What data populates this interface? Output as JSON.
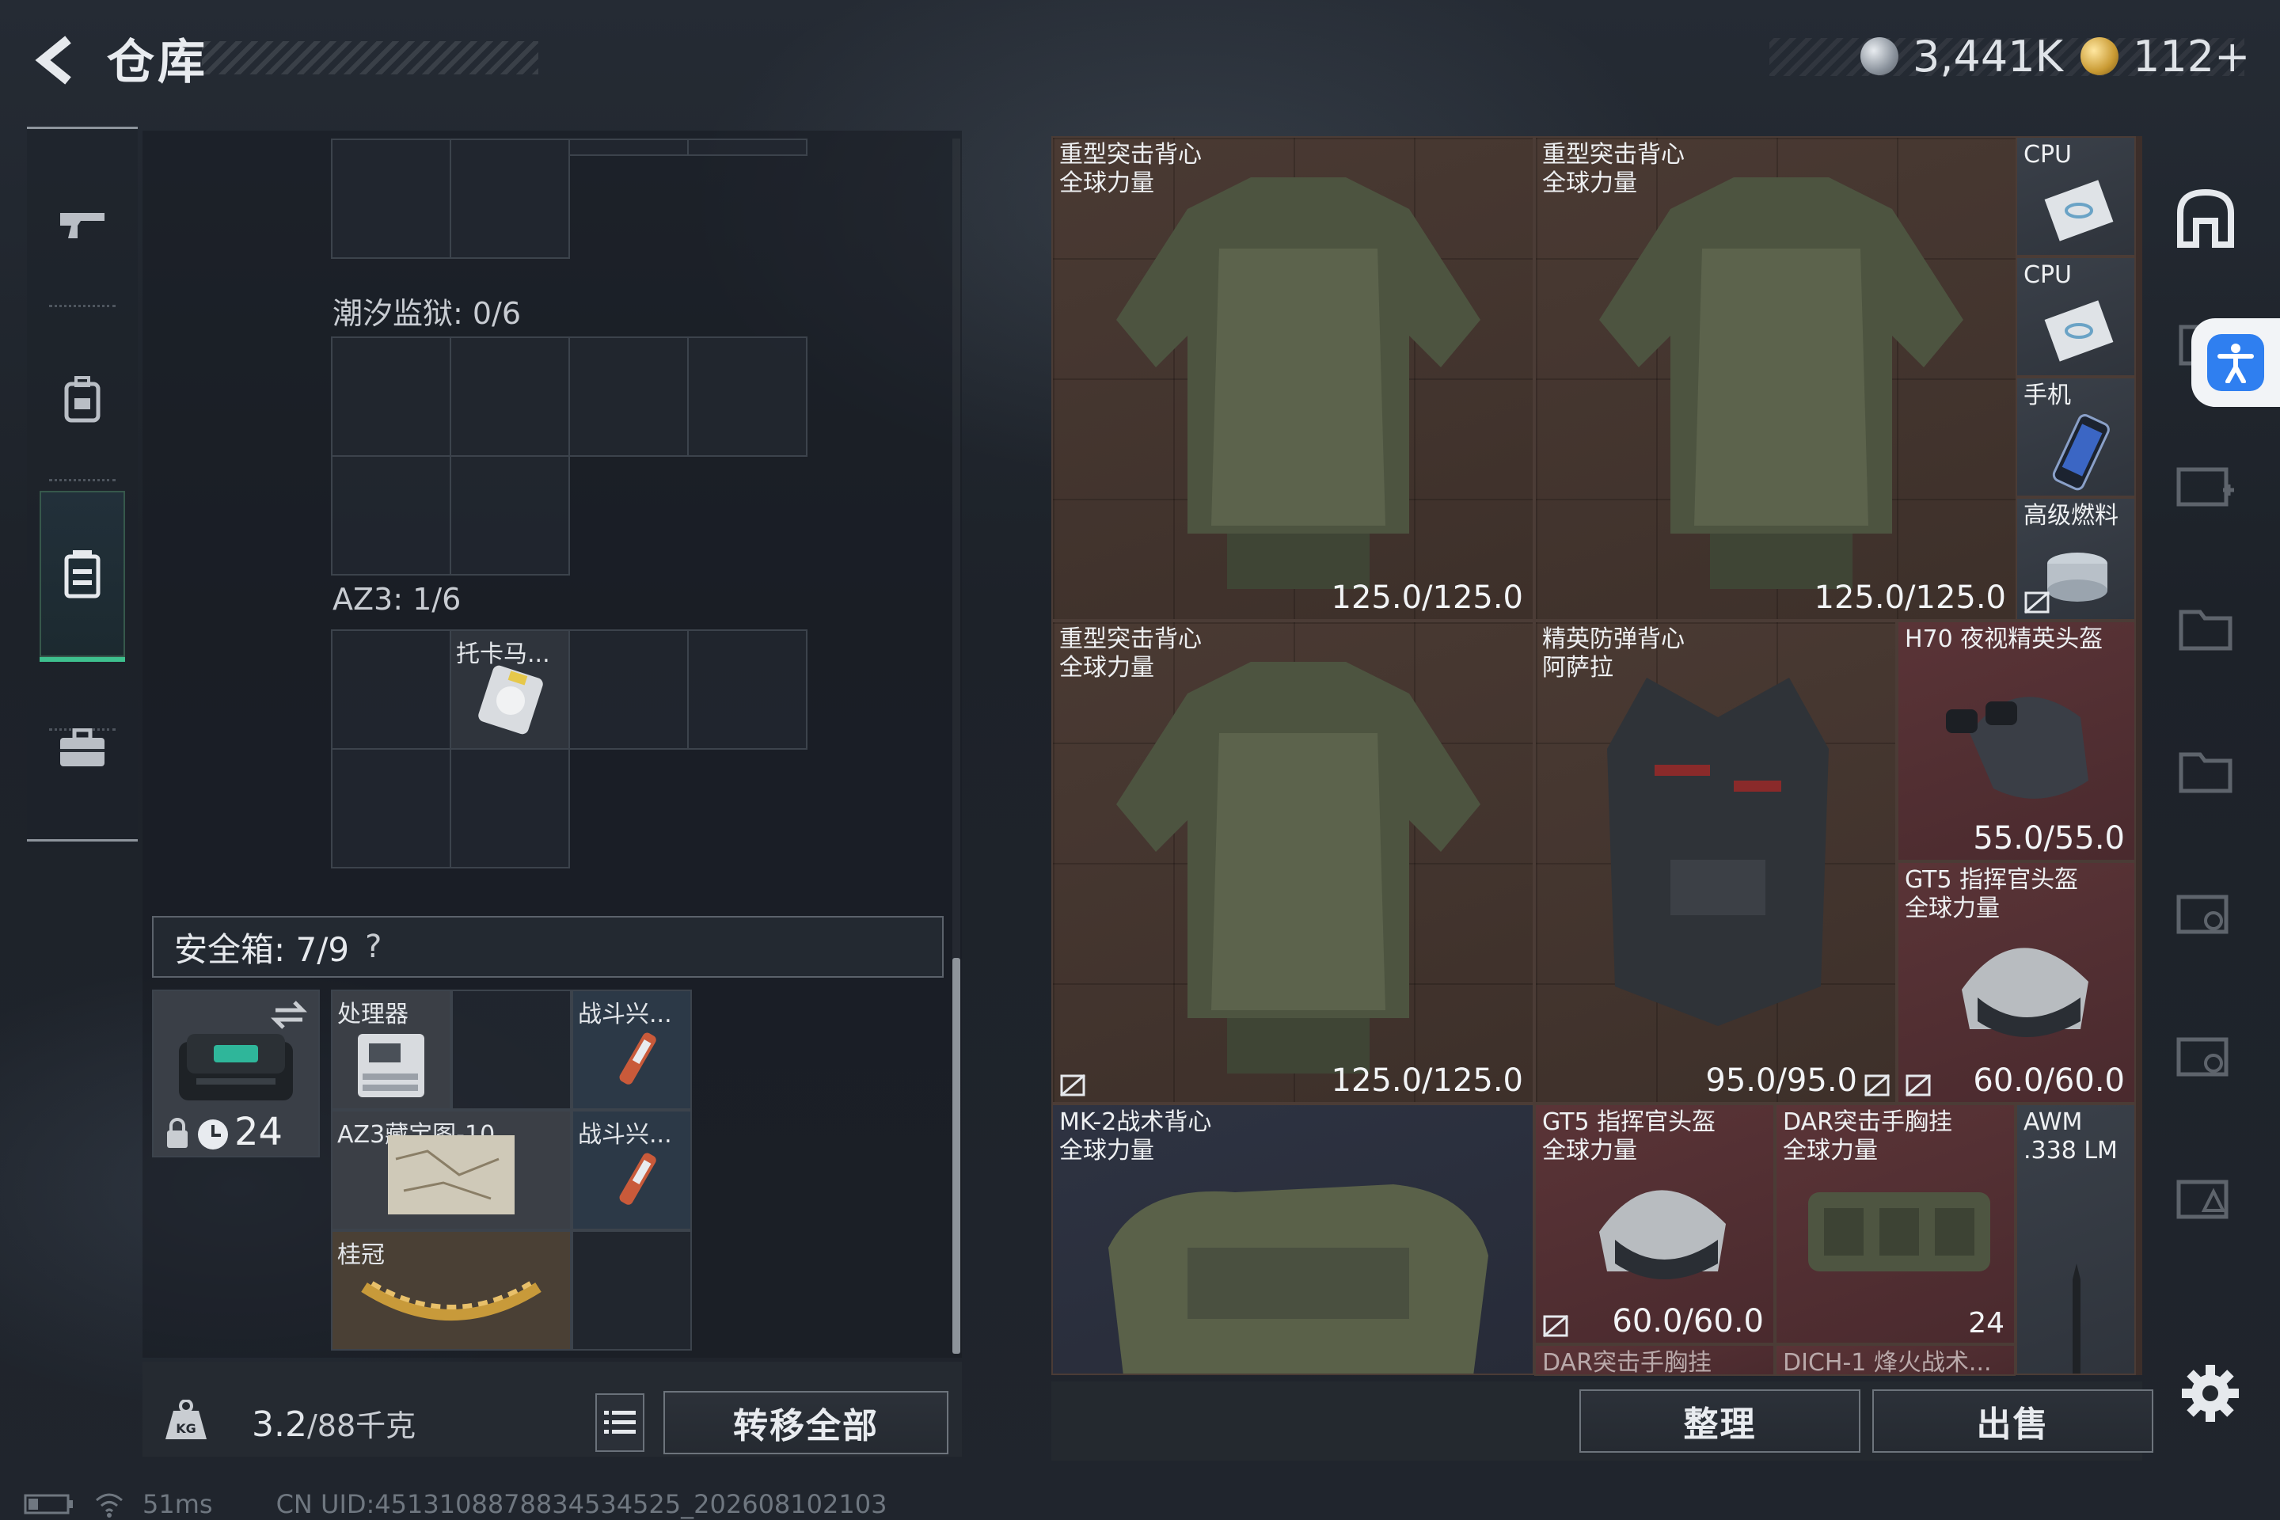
{
  "header": {
    "title": "仓库"
  },
  "currency": {
    "silver": "3,441K",
    "gold": "112+"
  },
  "stash": {
    "tidal_label": "潮汐监狱: 0/6",
    "az3_label": "AZ3: 1/6",
    "az3_item": "托卡马..."
  },
  "safe_box": {
    "label": "安全箱: 7/9",
    "help": "?",
    "timer": "24天",
    "items": {
      "processor": "处理器",
      "combat1": "战斗兴...",
      "map": "AZ3藏宝图-10",
      "combat2": "战斗兴...",
      "laurel": "桂冠"
    }
  },
  "footer_left": {
    "weight_value": "3.2",
    "weight_max": "/88千克",
    "transfer_all": "转移全部"
  },
  "tiles": {
    "vest1": {
      "name": "重型突击背心\n全球力量",
      "durability": "125.0/125.0"
    },
    "vest2": {
      "name": "重型突击背心\n全球力量",
      "durability": "125.0/125.0"
    },
    "cpu1": {
      "name": "CPU"
    },
    "cpu2": {
      "name": "CPU"
    },
    "phone": {
      "name": "手机"
    },
    "fuel": {
      "name": "高级燃料"
    },
    "vest3": {
      "name": "重型突击背心\n全球力量",
      "durability": "125.0/125.0"
    },
    "elite": {
      "name": "精英防弹背心\n阿萨拉",
      "durability": "95.0/95.0"
    },
    "h70": {
      "name": "H70 夜视精英头盔",
      "durability": "55.0/55.0"
    },
    "gt5a": {
      "name": "GT5 指挥官头盔\n全球力量",
      "durability": "60.0/60.0"
    },
    "mk2": {
      "name": "MK-2战术背心\n全球力量"
    },
    "gt5b": {
      "name": "GT5 指挥官头盔\n全球力量",
      "durability": "60.0/60.0"
    },
    "dar": {
      "name": "DAR突击手胸挂\n全球力量",
      "count": "24"
    },
    "awm": {
      "name": "AWM\n.338 LM"
    },
    "peek1": {
      "name": "DAR突击手胸挂"
    },
    "peek2": {
      "name": "DICH-1 烽火战术..."
    }
  },
  "footer_right": {
    "arrange": "整理",
    "sell": "出售"
  },
  "status": {
    "ping": "51ms",
    "uid": "CN UID:4513108878834534525_202608102103"
  },
  "colors": {
    "accent": "#3ec08e",
    "brown_tile": "#4a3a33",
    "red_tile": "#5a3437",
    "navy_tile": "#2e3342",
    "access": "#2f7ff0"
  },
  "icons": [
    "back-arrow-icon",
    "silver-coin-icon",
    "gold-coin-icon",
    "pistol-icon",
    "backpack-icon",
    "chest-rig-icon",
    "briefcase-icon",
    "weight-icon",
    "list-icon",
    "lock-icon",
    "clock-icon",
    "swap-icon",
    "home-icon",
    "accessibility-icon",
    "gear-icon",
    "no-insure-icon"
  ]
}
